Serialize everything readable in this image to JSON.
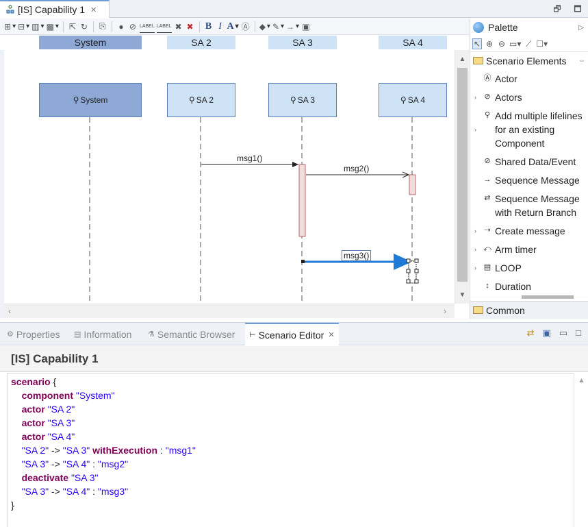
{
  "editor": {
    "tab_title": "[IS] Capability 1",
    "window_buttons": [
      "🗗",
      "🗖"
    ]
  },
  "toolbar": {
    "bold_label": "B",
    "italic_label": "I",
    "font_color_label": "A",
    "label_text_1": "LABEL",
    "label_text_2": "LABEL"
  },
  "lifeline_headers": [
    "System",
    "SA 2",
    "SA 3",
    "SA 4"
  ],
  "diagram": {
    "lifelines": [
      {
        "name": "System",
        "kind": "component",
        "color": "#8ea9d6"
      },
      {
        "name": "SA 2",
        "kind": "actor",
        "color": "#cfe3f7"
      },
      {
        "name": "SA 3",
        "kind": "actor",
        "color": "#cfe3f7"
      },
      {
        "name": "SA 4",
        "kind": "actor",
        "color": "#cfe3f7"
      }
    ],
    "messages": [
      {
        "label": "msg1()",
        "from": "SA 2",
        "to": "SA 3"
      },
      {
        "label": "msg2()",
        "from": "SA 3",
        "to": "SA 4"
      },
      {
        "label": "msg3()",
        "from": "SA 3",
        "to": "SA 4",
        "selected": true
      }
    ],
    "execution_color": "#f3dcdc",
    "selection_color": "#1e7ad6"
  },
  "palette": {
    "title": "Palette",
    "drawer_scenario": "Scenario Elements",
    "entries": [
      {
        "label": "Actor",
        "expandable": false,
        "icon": "actor-icon"
      },
      {
        "label": "Actors",
        "expandable": true,
        "icon": "actors-icon"
      },
      {
        "label": "Add multiple lifelines for an existing Component",
        "expandable": true,
        "icon": "lifelines-icon"
      },
      {
        "label": "Shared Data/Event",
        "expandable": false,
        "icon": "shared-data-icon"
      },
      {
        "label": "Sequence Message",
        "expandable": false,
        "icon": "sequence-message-icon"
      },
      {
        "label": "Sequence Message with Return Branch",
        "expandable": false,
        "icon": "return-branch-icon"
      },
      {
        "label": "Create message",
        "expandable": true,
        "icon": "create-message-icon"
      },
      {
        "label": "Arm timer",
        "expandable": true,
        "icon": "arm-timer-icon"
      },
      {
        "label": "LOOP",
        "expandable": true,
        "icon": "loop-icon"
      },
      {
        "label": "Duration",
        "expandable": false,
        "icon": "duration-icon"
      }
    ],
    "drawer_common": "Common"
  },
  "views": {
    "tabs": [
      {
        "label": "Properties",
        "active": false
      },
      {
        "label": "Information",
        "active": false
      },
      {
        "label": "Semantic Browser",
        "active": false
      },
      {
        "label": "Scenario Editor",
        "active": true
      }
    ]
  },
  "scenario_editor": {
    "title": "[IS] Capability 1",
    "lines": [
      [
        {
          "t": "kw",
          "v": "scenario"
        },
        {
          "t": "pn",
          "v": " {"
        }
      ],
      [
        {
          "t": "pn",
          "v": "    "
        },
        {
          "t": "kw",
          "v": "component"
        },
        {
          "t": "pn",
          "v": " "
        },
        {
          "t": "str",
          "v": "\"System\""
        }
      ],
      [
        {
          "t": "pn",
          "v": "    "
        },
        {
          "t": "kw",
          "v": "actor"
        },
        {
          "t": "pn",
          "v": " "
        },
        {
          "t": "str",
          "v": "\"SA 2\""
        }
      ],
      [
        {
          "t": "pn",
          "v": "    "
        },
        {
          "t": "kw",
          "v": "actor"
        },
        {
          "t": "pn",
          "v": " "
        },
        {
          "t": "str",
          "v": "\"SA 3\""
        }
      ],
      [
        {
          "t": "pn",
          "v": "    "
        },
        {
          "t": "kw",
          "v": "actor"
        },
        {
          "t": "pn",
          "v": " "
        },
        {
          "t": "str",
          "v": "\"SA 4\""
        }
      ],
      [
        {
          "t": "pn",
          "v": "    "
        },
        {
          "t": "str",
          "v": "\"SA 2\""
        },
        {
          "t": "pn",
          "v": " -> "
        },
        {
          "t": "str",
          "v": "\"SA 3\""
        },
        {
          "t": "pn",
          "v": " "
        },
        {
          "t": "kw",
          "v": "withExecution"
        },
        {
          "t": "pn",
          "v": " : "
        },
        {
          "t": "str",
          "v": "\"msg1\""
        }
      ],
      [
        {
          "t": "pn",
          "v": "    "
        },
        {
          "t": "str",
          "v": "\"SA 3\""
        },
        {
          "t": "pn",
          "v": " -> "
        },
        {
          "t": "str",
          "v": "\"SA 4\""
        },
        {
          "t": "pn",
          "v": " : "
        },
        {
          "t": "str",
          "v": "\"msg2\""
        }
      ],
      [
        {
          "t": "pn",
          "v": "    "
        },
        {
          "t": "kw",
          "v": "deactivate"
        },
        {
          "t": "pn",
          "v": " "
        },
        {
          "t": "str",
          "v": "\"SA 3\""
        }
      ],
      [
        {
          "t": "pn",
          "v": "    "
        },
        {
          "t": "str",
          "v": "\"SA 3\""
        },
        {
          "t": "pn",
          "v": " -> "
        },
        {
          "t": "str",
          "v": "\"SA 4\""
        },
        {
          "t": "pn",
          "v": " : "
        },
        {
          "t": "str",
          "v": "\"msg3\""
        }
      ],
      [
        {
          "t": "pn",
          "v": "}"
        }
      ]
    ]
  }
}
